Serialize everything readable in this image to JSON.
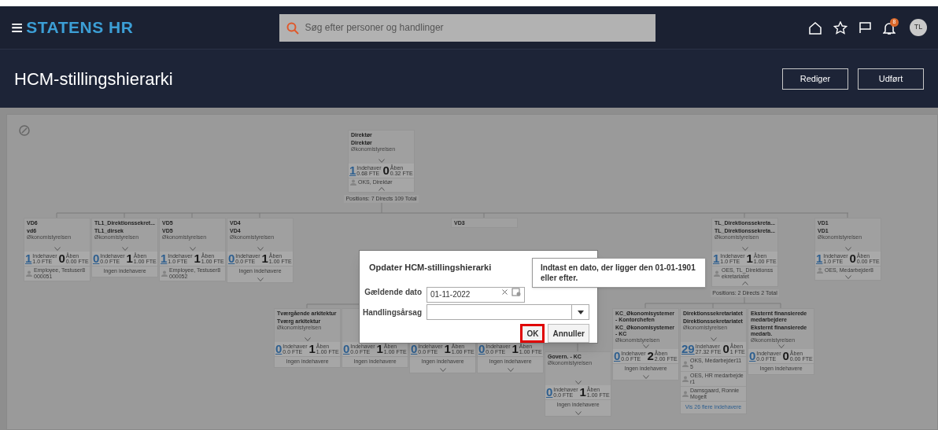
{
  "header": {
    "menu_icon": "≡",
    "logo": "STATENS HR",
    "search": {
      "placeholder": "Søg efter personer og handlinger"
    },
    "notification_count": "8",
    "avatar": "TL"
  },
  "page": {
    "title": "HCM-stillingshierarki",
    "buttons": [
      "Rediger",
      "Udført"
    ]
  },
  "cards": [
    {
      "title": "Direktør",
      "subtitle": "Direktør",
      "org": "Økonomistyrelsen",
      "holders": {
        "count": "1",
        "label": "Indehaver",
        "fte": "0.68 FTE"
      },
      "open": {
        "count": "0",
        "label": "Åben",
        "fte": "0.32 FTE"
      },
      "people": [
        "OKS, Direktør"
      ],
      "expandable": false,
      "collapsible": true,
      "footer": "Positions: 7 Directs 109 Total"
    },
    {
      "title": "VD6",
      "subtitle": "vd6",
      "org": "Økonomistyrelsen",
      "holders": {
        "count": "1",
        "label": "Indehaver",
        "fte": "1.0 FTE"
      },
      "open": {
        "count": "0",
        "label": "Åben",
        "fte": "0.00 FTE"
      },
      "people": [
        "Employee, Testuser8000051"
      ],
      "expandable": false,
      "collapsible": false
    },
    {
      "title": "TL1_Direktionssekret...",
      "subtitle": "TL1_dirsek",
      "org": "Økonomistyrelsen",
      "holders": {
        "count": "0",
        "label": "Indehaver",
        "fte": "0.0 FTE"
      },
      "open": {
        "count": "1",
        "label": "Åben",
        "fte": "1.00 FTE"
      },
      "no_holders": "Ingen indehavere",
      "expandable": false,
      "collapsible": false
    },
    {
      "title": "VD5",
      "subtitle": "VD5",
      "org": "Økonomistyrelsen",
      "holders": {
        "count": "1",
        "label": "Indehaver",
        "fte": "1.0 FTE"
      },
      "open": {
        "count": "1",
        "label": "Åben",
        "fte": "1.00 FTE"
      },
      "people": [
        "Employee, Testuser8000052"
      ],
      "expandable": false,
      "collapsible": false
    },
    {
      "title": "VD4",
      "subtitle": "VD4",
      "org": "Økonomistyrelsen",
      "holders": {
        "count": "0",
        "label": "Indehaver",
        "fte": "0.0 FTE"
      },
      "open": {
        "count": "1",
        "label": "Åben",
        "fte": "1.00 FTE"
      },
      "no_holders": "Ingen indehavere",
      "expandable": true,
      "collapsible": false
    },
    {
      "title": "VD3"
    },
    {
      "title": "TL_Direktionssekreta...",
      "subtitle": "TL_Direktionssekreta...",
      "org": "Økonomistyrelsen",
      "holders": {
        "count": "1",
        "label": "Indehaver",
        "fte": "1.0 FTE"
      },
      "open": {
        "count": "1",
        "label": "Åben",
        "fte": "1.00 FTE"
      },
      "people": [
        "OES, TL_Direktionssekretariatet"
      ],
      "expandable": false,
      "collapsible": true,
      "footer": "Positions: 2 Directs 2 Total"
    },
    {
      "title": "VD1",
      "subtitle": "VD1",
      "org": "Økonomistyrelsen",
      "holders": {
        "count": "1",
        "label": "Indehaver",
        "fte": "1.0 FTE"
      },
      "open": {
        "count": "0",
        "label": "Åben",
        "fte": "0.00 FTE"
      },
      "people": [
        "OES, Medarbejder8"
      ],
      "expandable": true,
      "collapsible": false
    },
    {
      "title": "Tværgående arkitektur",
      "subtitle": "Tværg arkitektur",
      "org": "Økonomistyrelsen",
      "holders": {
        "count": "0",
        "label": "Indehaver",
        "fte": "0.0 FTE"
      },
      "open": {
        "count": "1",
        "label": "Åben",
        "fte": "1.00 FTE"
      },
      "no_holders": "Ingen indehavere",
      "expandable": false,
      "collapsible": false
    },
    {
      "holders": {
        "count": "0",
        "label": "Indehaver",
        "fte": "0.0 FTE"
      },
      "open": {
        "count": "1",
        "label": "Åben",
        "fte": "1.00 FTE"
      },
      "no_holders": "Ingen indehavere",
      "expandable": false,
      "collapsible": false
    },
    {
      "holders": {
        "count": "0",
        "label": "Indehaver",
        "fte": "0.0 FTE"
      },
      "open": {
        "count": "1",
        "label": "Åben",
        "fte": "1.00 FTE"
      },
      "no_holders": "Ingen indehavere",
      "expandable": true,
      "collapsible": false
    },
    {
      "holders": {
        "count": "0",
        "label": "Indehaver",
        "fte": "0.0 FTE"
      },
      "open": {
        "count": "1",
        "label": "Åben",
        "fte": "1.00 FTE"
      },
      "no_holders": "Ingen indehavere",
      "expandable": true,
      "collapsible": false
    },
    {
      "title": "Govern. - KC",
      "org": "Økonomistyrelsen",
      "holders": {
        "count": "0",
        "label": "Indehaver",
        "fte": "0.0 FTE"
      },
      "open": {
        "count": "1",
        "label": "Åben",
        "fte": "1.00 FTE"
      },
      "no_holders": "Ingen indehavere",
      "expandable": true,
      "collapsible": false
    },
    {
      "title": "KC_Økonomisystemer - Kontorchefen",
      "subtitle": "KC_Økonomisystemer - KC",
      "org": "Økonomistyrelsen",
      "holders": {
        "count": "0",
        "label": "Indehaver",
        "fte": "0.0 FTE"
      },
      "open": {
        "count": "2",
        "label": "Åben",
        "fte": "2.00 FTE"
      },
      "no_holders": "Ingen indehavere",
      "expandable": true,
      "collapsible": false
    },
    {
      "title": "Direktionssekretariatet",
      "subtitle": "Direktionssekretariatet",
      "org": "Økonomistyrelsen",
      "holders": {
        "count": "29",
        "label": "Indehaver",
        "fte": "27.32 FTE"
      },
      "open": {
        "count": "0",
        "label": "Åben",
        "fte": "1 FTE"
      },
      "people": [
        "OKS, Medarbejder115",
        "OES, HR medarbejder1",
        "Damsgaard, Ronnie Mogelt"
      ],
      "more_link": "Vis 26 flere indehavere",
      "expandable": false,
      "collapsible": false
    },
    {
      "title": "Eksternt finansierede medarbejdere",
      "subtitle": "Eksternt finansierede medarb.",
      "org": "Økonomistyrelsen",
      "holders": {
        "count": "0",
        "label": "Indehaver",
        "fte": "0.0 FTE"
      },
      "open": {
        "count": "0",
        "label": "Åben",
        "fte": "0.00 FTE"
      },
      "no_holders": "Ingen indehavere",
      "expandable": false,
      "collapsible": false
    }
  ],
  "dialog": {
    "title": "Opdater HCM-stillingshierarki",
    "fields": [
      {
        "kind": "date",
        "label": "Gældende dato",
        "value": "01-11-2022"
      },
      {
        "kind": "select",
        "label": "Handlingsårsag"
      }
    ],
    "tooltip": "Indtast en dato, der ligger den 01-01-1901 eller efter.",
    "buttons": [
      {
        "label": "OK",
        "highlighted": true
      },
      {
        "label": "Annuller",
        "highlighted": false
      }
    ]
  }
}
